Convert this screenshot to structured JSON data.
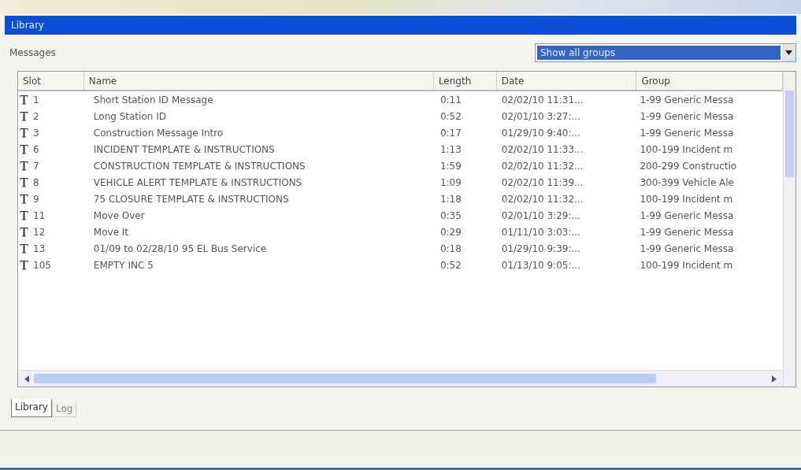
{
  "window": {
    "title": "Library"
  },
  "messages_label": "Messages",
  "group_filter": {
    "value": "Show all groups"
  },
  "table": {
    "columns": [
      "Slot",
      "Name",
      "Length",
      "Date",
      "Group"
    ],
    "rows": [
      {
        "slot": "1",
        "name": "Short Station ID Message",
        "length": "0:11",
        "date": "02/02/10 11:31...",
        "group": "1-99 Generic Messa"
      },
      {
        "slot": "2",
        "name": "Long Station ID",
        "length": "0:52",
        "date": "02/01/10 3:27:...",
        "group": "1-99 Generic Messa"
      },
      {
        "slot": "3",
        "name": "Construction Message Intro",
        "length": "0:17",
        "date": "01/29/10 9:40:...",
        "group": "1-99 Generic Messa"
      },
      {
        "slot": "6",
        "name": "INCIDENT TEMPLATE & INSTRUCTIONS",
        "length": "1:13",
        "date": "02/02/10 11:33...",
        "group": "100-199 Incident m"
      },
      {
        "slot": "7",
        "name": "CONSTRUCTION TEMPLATE & INSTRUCTIONS",
        "length": "1:59",
        "date": "02/02/10 11:32...",
        "group": "200-299 Constructio"
      },
      {
        "slot": "8",
        "name": "VEHICLE ALERT TEMPLATE & INSTRUCTIONS",
        "length": "1:09",
        "date": "02/02/10 11:39...",
        "group": "300-399 Vehicle Ale"
      },
      {
        "slot": "9",
        "name": "75 CLOSURE TEMPLATE & INSTRUCTIONS",
        "length": "1:18",
        "date": "02/02/10 11:32...",
        "group": "100-199 Incident m"
      },
      {
        "slot": "11",
        "name": "Move Over",
        "length": "0:35",
        "date": "02/01/10 3:29:...",
        "group": "1-99 Generic Messa"
      },
      {
        "slot": "12",
        "name": "Move It",
        "length": "0:29",
        "date": "01/11/10 3:03:...",
        "group": "1-99 Generic Messa"
      },
      {
        "slot": "13",
        "name": "01/09 to 02/28/10 95 EL Bus Service",
        "length": "0:18",
        "date": "01/29/10 9:39:...",
        "group": "1-99 Generic Messa"
      },
      {
        "slot": "105",
        "name": "EMPTY INC 5",
        "length": "0:52",
        "date": "01/13/10 9:05:...",
        "group": "100-199 Incident m"
      }
    ]
  },
  "tabs": [
    {
      "label": "Library",
      "selected": true,
      "disabled": false
    },
    {
      "label": "Log",
      "selected": false,
      "disabled": true
    }
  ]
}
